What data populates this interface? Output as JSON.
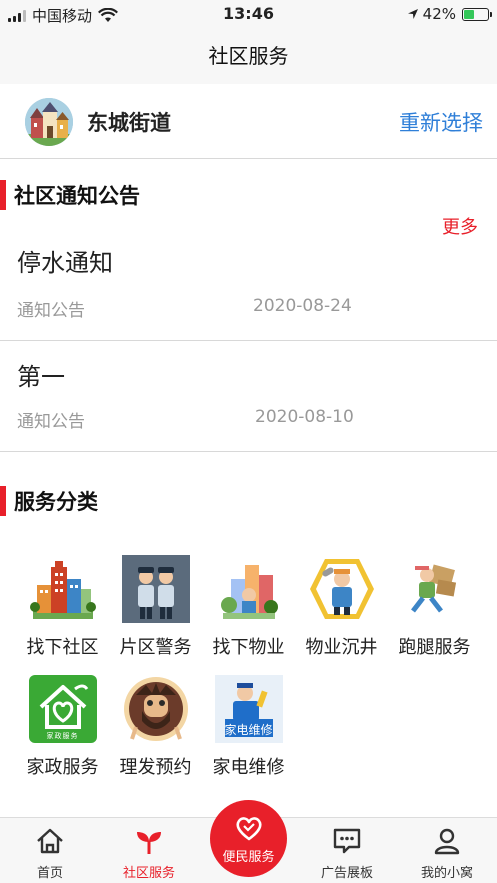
{
  "status_bar": {
    "carrier": "中国移动",
    "time": "13:46",
    "battery_percent": "42%",
    "battery_level": 0.42
  },
  "nav": {
    "title": "社区服务"
  },
  "location": {
    "name": "东城街道",
    "reselect_label": "重新选择"
  },
  "notices_section": {
    "title": "社区通知公告",
    "more_label": "更多",
    "items": [
      {
        "title": "停水通知",
        "category": "通知公告",
        "date": "2020-08-24"
      },
      {
        "title": "第一",
        "category": "通知公告",
        "date": "2020-08-10"
      }
    ]
  },
  "services_section": {
    "title": "服务分类",
    "items": [
      {
        "label": "找下社区",
        "icon": "community-buildings-icon"
      },
      {
        "label": "片区警务",
        "icon": "police-officers-icon"
      },
      {
        "label": "找下物业",
        "icon": "property-city-icon"
      },
      {
        "label": "物业沉井",
        "icon": "repair-worker-icon"
      },
      {
        "label": "跑腿服务",
        "icon": "courier-runner-icon"
      },
      {
        "label": "家政服务",
        "icon": "housekeeping-home-icon",
        "badge_text": "家政服务"
      },
      {
        "label": "理发预约",
        "icon": "barber-icon"
      },
      {
        "label": "家电维修",
        "icon": "appliance-repair-icon",
        "badge_text": "家电维修"
      }
    ]
  },
  "tab_bar": {
    "tabs": [
      {
        "label": "首页",
        "icon": "home-icon"
      },
      {
        "label": "社区服务",
        "icon": "sprout-icon",
        "active": true
      },
      {
        "label": "便民服务",
        "icon": "heart-icon"
      },
      {
        "label": "广告展板",
        "icon": "message-board-icon"
      },
      {
        "label": "我的小窝",
        "icon": "user-icon"
      }
    ]
  },
  "colors": {
    "accent_red": "#e8202a",
    "link_blue": "#2f7fd8",
    "muted_text": "#999999"
  }
}
